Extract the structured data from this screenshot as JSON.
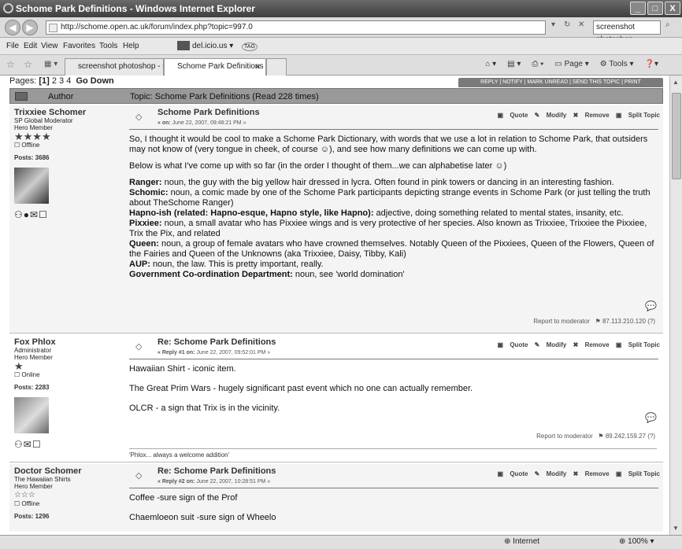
{
  "window": {
    "title": "Schome Park Definitions - Windows Internet Explorer",
    "min": "_",
    "max": "□",
    "close": "X"
  },
  "address": {
    "url": "http://schome.open.ac.uk/forum/index.php?topic=997.0",
    "search_value": "screenshot photoshop"
  },
  "menu": {
    "items": [
      "File",
      "Edit",
      "View",
      "Favorites",
      "Tools",
      "Help"
    ],
    "delicious": "del.icio.us",
    "tag": "TAG"
  },
  "tabs": [
    {
      "label": "screenshot photoshop - Goo..."
    },
    {
      "label": "Schome Park Definitions"
    }
  ],
  "toolbar": {
    "page": "Page",
    "tools": "Tools"
  },
  "forum": {
    "pages_label": "Pages:",
    "current_page": "[1]",
    "pages": [
      "2",
      "3",
      "4"
    ],
    "go_down": "Go Down",
    "actions": "REPLY | NOTIFY | MARK UNREAD | SEND THIS TOPIC | PRINT",
    "author_col": "Author",
    "topic_col": "Topic: Schome Park Definitions  (Read 228 times)"
  },
  "post_tools": {
    "quote": "Quote",
    "modify": "Modify",
    "remove": "Remove",
    "split": "Split Topic",
    "report": "Report to moderator"
  },
  "posts": [
    {
      "author": "Trixxiee Schomer",
      "role1": "SP Global Moderator",
      "role2": "Hero Member",
      "stars": "★★★★",
      "status": "Offline",
      "posts": "Posts: 3686",
      "subject": "Schome Park Definitions",
      "date_prefix": "« on:",
      "date": " June 22, 2007, 09:48:21 PM »",
      "intro": "So, I thought it would be cool to make a Schome Park Dictionary, with words that we use a lot in relation to Schome Park, that outsiders may not know of (very tongue in cheek, of course ☺), and see how many definitions we can come up with.",
      "intro2": "Below is what I've come up with so far (in the order I thought of them...we can alphabetise later ☺)",
      "defs": [
        {
          "term": "Ranger:",
          "text": " noun, the guy with the big yellow hair dressed in lycra. Often found in pink towers or dancing in an interesting fashion."
        },
        {
          "term": "Schomic:",
          "text": " noun, a comic made by one of the Schome Park participants depicting strange events in Schome Park (or just telling the truth about TheSchome Ranger)"
        },
        {
          "term": "Hapno-ish (related: Hapno-esque, Hapno style, like Hapno):",
          "text": " adjective, doing something related to mental states, insanity, etc."
        },
        {
          "term": "Pixxiee:",
          "text": " noun, a small avatar who has Pixxiee wings and is very protective of her species. Also known as Trixxiee, Trixxiee the Pixxiee, Trix the Pix, and related"
        },
        {
          "term": "Queen:",
          "text": " noun, a group of female avatars who have crowned themselves. Notably Queen of the Pixxiees, Queen of the Flowers, Queen of the Fairies and Queen of the Unknowns (aka Trixxiee, Daisy, Tibby, Kali)"
        },
        {
          "term": "AUP:",
          "text": " noun, the law. This is pretty important, really."
        },
        {
          "term": "Government Co-ordination Department:",
          "text": " noun, see 'world domination'"
        }
      ],
      "ip": "87.113.210.120 (?)"
    },
    {
      "author": "Fox Phlox",
      "role1": "Administrator",
      "role2": "Hero Member",
      "stars": "★",
      "status": "Online",
      "posts": "Posts: 2283",
      "subject": "Re: Schome Park Definitions",
      "date_prefix": "« Reply #1 on:",
      "date": " June 22, 2007, 09:52:01 PM »",
      "lines": [
        "Hawaiian Shirt - iconic item.",
        "The Great Prim Wars - hugely significant past event which no one can actually remember.",
        "OLCR - a sign that Trix is in the vicinity."
      ],
      "ip": "89.242.159.27 (?)",
      "signature": "'Phlox... always a welcome addition'"
    },
    {
      "author": "Doctor Schomer",
      "role1": "The Hawaiian Shirts",
      "role2": "Hero Member",
      "stars": "☆☆☆",
      "status": "Offline",
      "posts": "Posts: 1296",
      "subject": "Re: Schome Park Definitions",
      "date_prefix": "« Reply #2 on:",
      "date": " June 22, 2007, 10:28:51 PM »",
      "lines": [
        "Coffee -sure sign of the Prof",
        "Chaemloeon suit -sure sign of Wheelo"
      ]
    }
  ],
  "status": {
    "zone": "Internet",
    "zoom": "100%"
  }
}
